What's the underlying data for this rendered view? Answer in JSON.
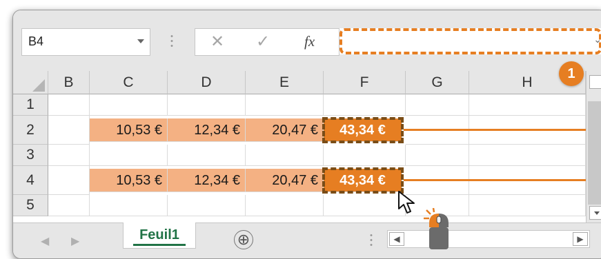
{
  "name_box": {
    "value": "B4"
  },
  "formula_bar": {
    "fx_label": "fx",
    "cancel_glyph": "✕",
    "enter_glyph": "✓",
    "content": ""
  },
  "columns": [
    "B",
    "C",
    "D",
    "E",
    "F",
    "G",
    "H"
  ],
  "rows": [
    "1",
    "2",
    "3",
    "4",
    "5"
  ],
  "cells": {
    "C2": "10,53 €",
    "D2": "12,34 €",
    "E2": "20,47 €",
    "F2": "43,34 €",
    "C4": "10,53 €",
    "D4": "12,34 €",
    "E4": "20,47 €",
    "F4": "43,34 €"
  },
  "callout": {
    "badge": "1"
  },
  "sheet_tabs": [
    {
      "label": "Feuil1",
      "active": true
    }
  ],
  "add_sheet_glyph": "⊕",
  "nav": {
    "prev": "◀",
    "next": "▶"
  },
  "colors": {
    "accent": "#e67e22",
    "cell_fill": "#f4b183",
    "tab_green": "#217346",
    "dashed_outline": "#7a4d17"
  },
  "icons": [
    "name-box-dropdown-icon",
    "cancel-icon",
    "enter-icon",
    "fx-icon",
    "formula-expand-icon",
    "mouse-pointer-icon",
    "mouse-click-icon",
    "add-sheet-icon"
  ]
}
